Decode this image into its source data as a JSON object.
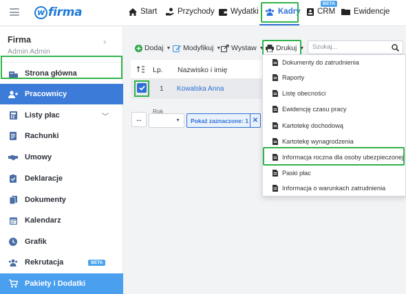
{
  "app": {
    "logo": "firma",
    "logo_w": "w"
  },
  "topnav": {
    "start": "Start",
    "przychody": "Przychody",
    "wydatki": "Wydatki",
    "kadry": "Kadry",
    "crm": "CRM",
    "crm_badge": "BETA",
    "ewidencje": "Ewidencje"
  },
  "sidebar": {
    "firma_title": "Firma",
    "firma_user": "Admin Admin",
    "items": [
      {
        "label": "Strona główna",
        "icon": "building-icon"
      },
      {
        "label": "Pracownicy",
        "icon": "user-plus-icon"
      },
      {
        "label": "Listy płac",
        "icon": "calculator-icon"
      },
      {
        "label": "Rachunki",
        "icon": "document-icon"
      },
      {
        "label": "Umowy",
        "icon": "handshake-icon"
      },
      {
        "label": "Deklaracje",
        "icon": "clipboard-check-icon"
      },
      {
        "label": "Dokumenty",
        "icon": "files-icon"
      },
      {
        "label": "Kalendarz",
        "icon": "calendar-icon"
      },
      {
        "label": "Grafik",
        "icon": "clock-icon"
      },
      {
        "label": "Rekrutacja",
        "icon": "users-icon",
        "badge": "BETA"
      },
      {
        "label": "Pakiety i Dodatki",
        "icon": "cart-icon"
      }
    ]
  },
  "toolbar": {
    "dodaj": "Dodaj",
    "modyfikuj": "Modyfikuj",
    "wystaw": "Wystaw",
    "drukuj": "Drukuj",
    "search_placeholder": "Szukaj..."
  },
  "table": {
    "col_lp": "Lp.",
    "col_name": "Nazwisko i imię",
    "rows": [
      {
        "lp": "1",
        "name": "Kowalska Anna",
        "checked": true
      }
    ]
  },
  "filters": {
    "rok_label": "Rok",
    "show_selected": "Pokaż zaznaczone: 1",
    "clear": "✕"
  },
  "print_menu": {
    "items": [
      "Dokumenty do zatrudnienia",
      "Raporty",
      "Listę obecności",
      "Ewidencję czasu pracy",
      "Kartotekę dochodową",
      "Kartotekę wynagrodzenia",
      "Informacja roczna dla osoby ubezpieczonej",
      "Paski płac",
      "Informacja o warunkach zatrudnienia"
    ],
    "highlighted_index": 6
  },
  "colors": {
    "accent": "#2d6fd6",
    "highlight_green": "#2fb24a",
    "sidebar_active": "#3d7bd9",
    "sidebar_bottom": "#4a9fee",
    "link": "#2d6fd6"
  }
}
